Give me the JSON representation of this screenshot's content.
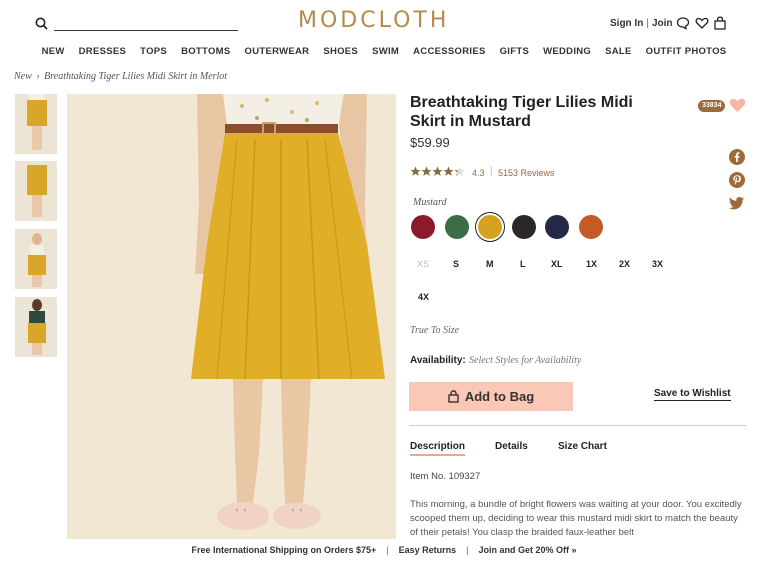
{
  "header": {
    "logo": "MODCLOTH",
    "sign_in": "Sign In",
    "join": "Join"
  },
  "nav": [
    "NEW",
    "DRESSES",
    "TOPS",
    "BOTTOMS",
    "OUTERWEAR",
    "SHOES",
    "SWIM",
    "ACCESSORIES",
    "GIFTS",
    "WEDDING",
    "SALE",
    "OUTFIT PHOTOS"
  ],
  "breadcrumb": {
    "parent": "New",
    "current": "Breathtaking Tiger Lilies Midi Skirt in Merlot"
  },
  "product": {
    "title": "Breathtaking Tiger Lilies Midi Skirt in Mustard",
    "price": "$59.99",
    "wishlist_count": "33834",
    "rating": "4.3",
    "rating_fraction": 0.86,
    "reviews": "5153 Reviews",
    "selected_color": "Mustard",
    "swatches": [
      {
        "name": "Merlot",
        "color": "#8c1a2b"
      },
      {
        "name": "Green",
        "color": "#3b6e46"
      },
      {
        "name": "Mustard",
        "color": "#d4a21f",
        "selected": true
      },
      {
        "name": "Black",
        "color": "#2b2628"
      },
      {
        "name": "Navy",
        "color": "#232946"
      },
      {
        "name": "Rust",
        "color": "#c45a25"
      }
    ],
    "sizes": [
      "XS",
      "S",
      "M",
      "L",
      "XL",
      "1X",
      "2X",
      "3X",
      "4X"
    ],
    "fit": "True To Size",
    "availability_label": "Availability:",
    "availability_value": "Select Styles for Availability",
    "add_to_bag": "Add to Bag",
    "save_to_wishlist": "Save to Wishlist",
    "tabs": [
      "Description",
      "Details",
      "Size Chart"
    ],
    "item_no": "Item No. 109327",
    "description": "This morning, a bundle of bright flowers was waiting at your door. You excitedly scooped them up, deciding to wear this mustard midi skirt to match the beauty of their petals! You clasp the braided faux-leather belt"
  },
  "footer": {
    "shipping": "Free International Shipping on Orders $75+",
    "returns": "Easy Returns",
    "join": "Join and Get 20% Off »"
  },
  "colors": {
    "brand": "#b38b4e",
    "add_to_bag_bg": "#fbc7b6",
    "heart": "#f5b6a6"
  }
}
